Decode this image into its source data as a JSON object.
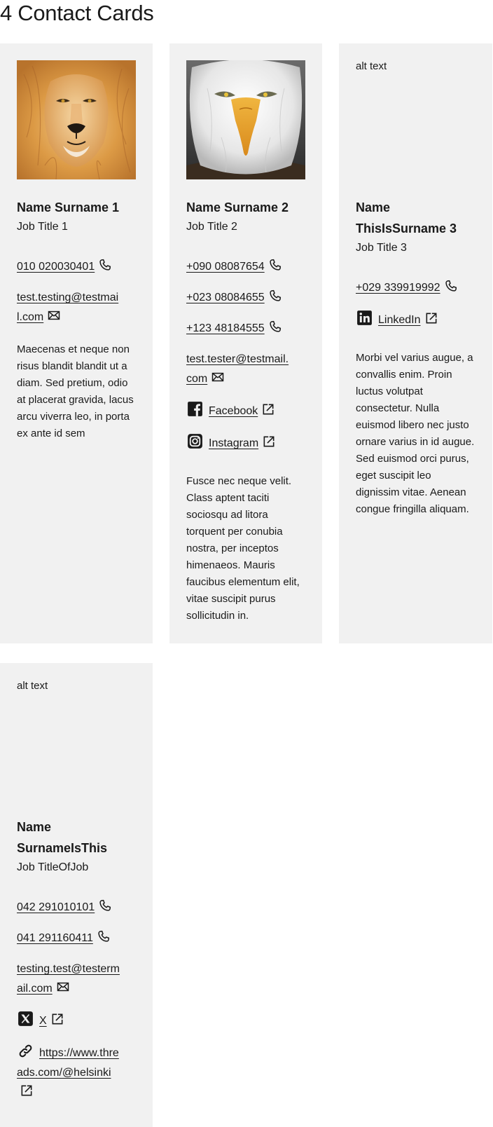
{
  "page": {
    "title": "4 Contact Cards"
  },
  "cards": [
    {
      "image_alt": "alt text",
      "name": "Name Surname 1",
      "job": "Job Title 1",
      "phones": [
        "010 020030401"
      ],
      "email_lines": [
        "test.testing@testmai",
        "l.com"
      ],
      "description": "Maecenas et neque non risus blandit blandit ut a diam. Sed pretium, odio at placerat gravida, lacus arcu viverra leo, in porta ex ante id sem"
    },
    {
      "image_alt": "alt text",
      "name": "Name Surname 2",
      "job": "Job Title 2",
      "phones": [
        "+090 08087654",
        "+023 08084655",
        "+123 48184555"
      ],
      "email_lines": [
        "test.tester@testmail.",
        "com"
      ],
      "social": [
        {
          "label": "Facebook",
          "icon": "facebook-icon"
        },
        {
          "label": "Instagram",
          "icon": "instagram-icon"
        }
      ],
      "description": "Fusce nec neque velit. Class aptent taciti sociosqu ad litora torquent per conubia nostra, per inceptos himenaeos. Mauris faucibus elementum elit, vitae suscipit purus sollicitudin in."
    },
    {
      "image_alt": "alt text",
      "name_lines": [
        "Name",
        "ThisIsSurname 3"
      ],
      "job": "Job Title 3",
      "phones": [
        "+029 339919992"
      ],
      "social": [
        {
          "label": "LinkedIn",
          "icon": "linkedin-icon"
        }
      ],
      "description": "Morbi vel varius augue, a convallis enim. Proin luctus volutpat consectetur. Nulla euismod libero nec justo ornare varius in id augue. Sed euismod orci purus, eget suscipit leo dignissim vitae. Aenean congue fringilla aliquam."
    },
    {
      "image_alt": "alt text",
      "name_lines": [
        "Name",
        "SurnameIsThis"
      ],
      "job": "Job TitleOfJob",
      "phones": [
        "042 291010101",
        "041 291160411"
      ],
      "email_lines": [
        "testing.test@testerm",
        "ail.com"
      ],
      "social": [
        {
          "label": "X",
          "icon": "x-icon"
        }
      ],
      "link_lines": [
        "https://www.thre",
        "ads.com/@helsinki"
      ]
    }
  ]
}
